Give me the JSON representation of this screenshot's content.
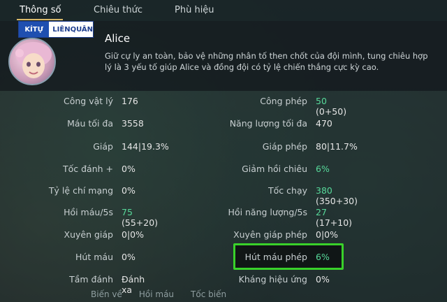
{
  "tabs": [
    "Thông số",
    "Chiêu thức",
    "Phù hiệu"
  ],
  "watermark": {
    "left": "KÍTỰ",
    "right": "LIÊNQUÂN"
  },
  "hero": {
    "name": "Alice",
    "description": "Giữ cự ly an toàn, bảo vệ những nhân tố then chốt của đội mình, tung chiêu hợp lý là 3 yếu tố giúp Alice và đồng đội có tỷ lệ chiến thắng cực kỳ cao."
  },
  "stats_left": [
    {
      "label": "Công vật lý",
      "value": "176"
    },
    {
      "label": "Máu tối đa",
      "value": "3558"
    },
    {
      "label": "Giáp",
      "value": "144|19.3%"
    },
    {
      "label": "Tốc đánh +",
      "value": "0%"
    },
    {
      "label": "Tỷ lệ chí mạng",
      "value": "0%"
    },
    {
      "label": "Hồi máu/5s",
      "value_main": "75",
      "value_rest": "(55+20)"
    },
    {
      "label": "Xuyên giáp",
      "value": "0|0%"
    },
    {
      "label": "Hút máu",
      "value": "0%"
    },
    {
      "label": "Tầm đánh",
      "value": "Đánh xa"
    }
  ],
  "stats_right": [
    {
      "label": "Công phép",
      "value_main": "50",
      "value_rest": "(0+50)"
    },
    {
      "label": "Năng lượng tối đa",
      "value": "470"
    },
    {
      "label": "Giáp phép",
      "value": "80|11.7%"
    },
    {
      "label": "Giảm hồi chiêu",
      "value": "6%"
    },
    {
      "label": "Tốc chạy",
      "value_main": "380",
      "value_rest": "(350+30)"
    },
    {
      "label": "Hồi năng lượng/5s",
      "value_main": "27",
      "value_rest": "(17+10)"
    },
    {
      "label": "Xuyên giáp phép",
      "value": "0|0%"
    },
    {
      "label": "Hút máu phép",
      "value": "6%"
    },
    {
      "label": "Kháng hiệu ứng",
      "value": "0%"
    }
  ],
  "bottom_tabs": [
    "Biến về",
    "Hồi máu",
    "Tốc biến"
  ],
  "colors": {
    "highlight_border": "#39d12a",
    "green_value": "#57d99a",
    "tab_underline": "#d8b96a"
  }
}
